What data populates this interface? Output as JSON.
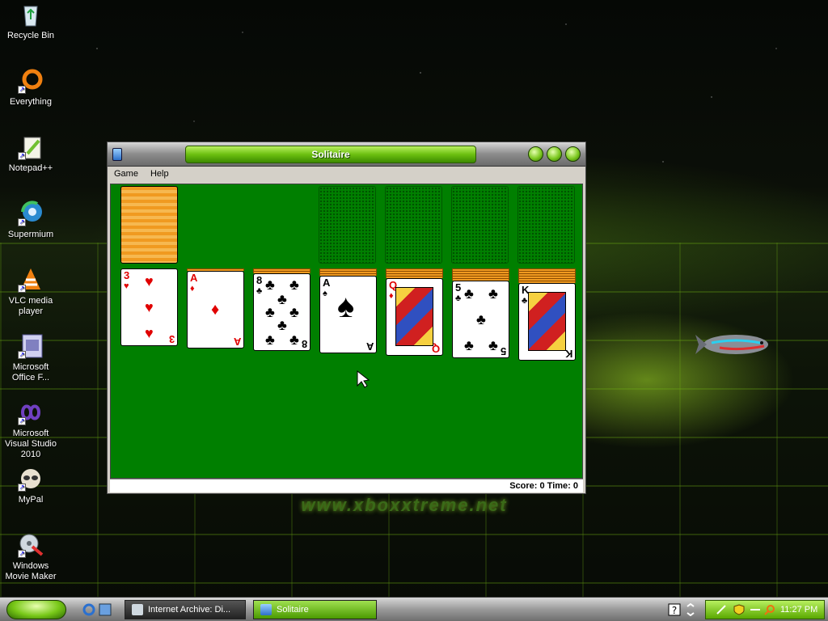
{
  "desktop": {
    "icons": [
      {
        "label": "Recycle Bin",
        "icon": "recycle-bin-icon"
      },
      {
        "label": "Everything",
        "icon": "everything-icon"
      },
      {
        "label": "Notepad++",
        "icon": "notepadpp-icon"
      },
      {
        "label": "Supermium",
        "icon": "supermium-icon"
      },
      {
        "label": "VLC media player",
        "icon": "vlc-icon"
      },
      {
        "label": "Microsoft Office F...",
        "icon": "office-icon"
      },
      {
        "label": "Microsoft Visual Studio 2010",
        "icon": "visual-studio-icon"
      },
      {
        "label": "MyPal",
        "icon": "mypal-icon"
      },
      {
        "label": "Windows Movie Maker",
        "icon": "movie-maker-icon"
      }
    ],
    "watermark": "www.xboxxtreme.net"
  },
  "window": {
    "title": "Solitaire",
    "menu": [
      "Game",
      "Help"
    ],
    "status": "Score: 0 Time: 0"
  },
  "tableau": [
    {
      "rank": "3",
      "suit": "♥",
      "color": "red",
      "hidden": 0
    },
    {
      "rank": "A",
      "suit": "♦",
      "color": "red",
      "hidden": 1
    },
    {
      "rank": "8",
      "suit": "♣",
      "color": "black",
      "hidden": 2
    },
    {
      "rank": "A",
      "suit": "♠",
      "color": "black",
      "hidden": 3
    },
    {
      "rank": "Q",
      "suit": "♦",
      "color": "red",
      "hidden": 4
    },
    {
      "rank": "5",
      "suit": "♣",
      "color": "black",
      "hidden": 5
    },
    {
      "rank": "K",
      "suit": "♣",
      "color": "black",
      "hidden": 6
    }
  ],
  "taskbar": {
    "tasks": [
      {
        "label": "Internet Archive: Di...",
        "active": false
      },
      {
        "label": "Solitaire",
        "active": true
      }
    ],
    "clock": "11:27 PM"
  },
  "colors": {
    "felt": "#007f00",
    "accent": "#6cc010",
    "card_back": "#f09a20"
  }
}
